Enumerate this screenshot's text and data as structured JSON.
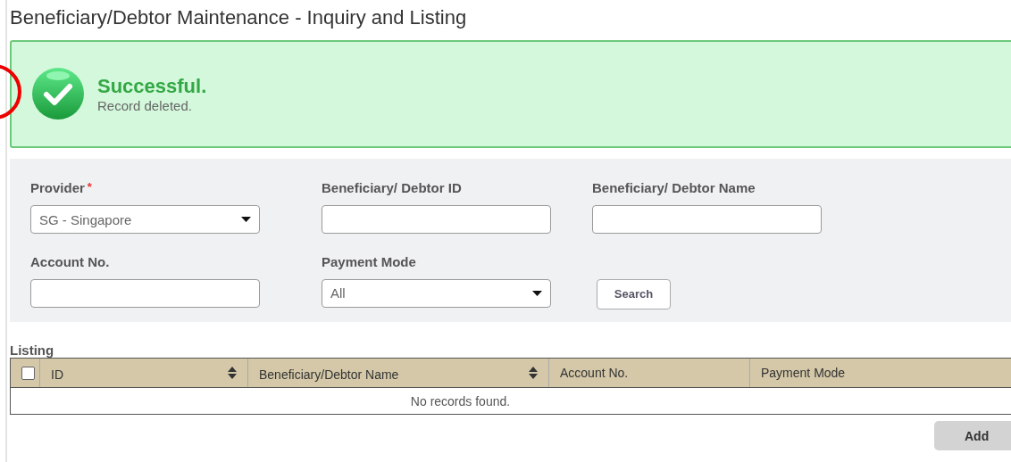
{
  "page": {
    "title": "Beneficiary/Debtor Maintenance - Inquiry and Listing"
  },
  "alert": {
    "kind": "success",
    "title": "Successful.",
    "message": "Record deleted."
  },
  "filters": [
    {
      "kind": "select",
      "label": "Provider",
      "required_mark": "*",
      "value": "SG - Singapore"
    },
    {
      "kind": "text",
      "label": "Beneficiary/ Debtor ID"
    },
    {
      "kind": "text",
      "label": "Beneficiary/ Debtor Name"
    },
    {
      "kind": "text",
      "label": "Account No."
    },
    {
      "kind": "select",
      "label": "Payment Mode",
      "value": "All"
    },
    {
      "kind": "button",
      "label": "Search"
    }
  ],
  "listing": {
    "label": "Listing",
    "select_all": {
      "checked": false
    },
    "columns": [
      {
        "label": "ID",
        "sortable": true
      },
      {
        "label": "Beneficiary/Debtor Name",
        "sortable": true
      },
      {
        "label": "Account No.",
        "sortable": false
      },
      {
        "label": "Payment Mode",
        "sortable": false
      }
    ],
    "empty_message": "No records found."
  },
  "add_button": {
    "label": "Add"
  }
}
